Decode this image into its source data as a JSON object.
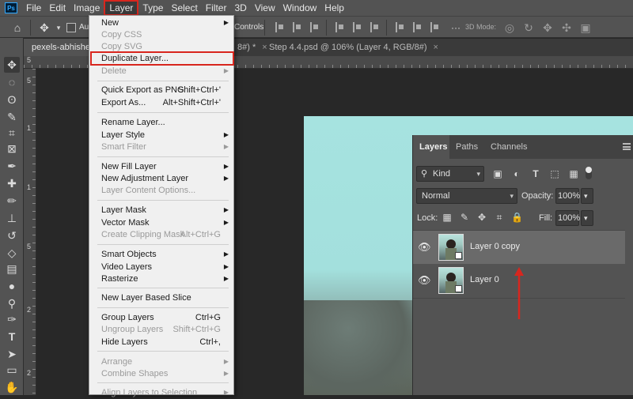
{
  "menubar": {
    "logo": "Ps",
    "items": [
      "File",
      "Edit",
      "Image",
      "Layer",
      "Type",
      "Select",
      "Filter",
      "3D",
      "View",
      "Window",
      "Help"
    ]
  },
  "options_bar": {
    "auto_select_label": "Au",
    "transform_controls_label": "Controls",
    "mode_3d_label": "3D Mode:"
  },
  "tabs": [
    {
      "label": "pexels-abhishek",
      "close": "×"
    },
    {
      "label": "8#) *",
      "close": "×"
    },
    {
      "label": "Step 4.4.psd @ 106% (Layer 4, RGB/8#)",
      "close": "×"
    }
  ],
  "rulers": {
    "top_mark": "5",
    "left_marks": [
      "5",
      "1",
      "1",
      "5",
      "2",
      "2"
    ]
  },
  "layer_menu": {
    "items": [
      {
        "label": "New",
        "shortcut": "",
        "submenu": true,
        "disabled": false
      },
      {
        "label": "Copy CSS",
        "shortcut": "",
        "submenu": false,
        "disabled": true
      },
      {
        "label": "Copy SVG",
        "shortcut": "",
        "submenu": false,
        "disabled": true
      },
      {
        "label": "Duplicate Layer...",
        "shortcut": "",
        "submenu": false,
        "disabled": false
      },
      {
        "label": "Delete",
        "shortcut": "",
        "submenu": true,
        "disabled": true
      },
      {
        "label": "Quick Export as PNG",
        "shortcut": "Shift+Ctrl+'",
        "submenu": false,
        "disabled": false
      },
      {
        "label": "Export As...",
        "shortcut": "Alt+Shift+Ctrl+'",
        "submenu": false,
        "disabled": false
      },
      {
        "label": "Rename Layer...",
        "shortcut": "",
        "submenu": false,
        "disabled": false
      },
      {
        "label": "Layer Style",
        "shortcut": "",
        "submenu": true,
        "disabled": false
      },
      {
        "label": "Smart Filter",
        "shortcut": "",
        "submenu": true,
        "disabled": true
      },
      {
        "label": "New Fill Layer",
        "shortcut": "",
        "submenu": true,
        "disabled": false
      },
      {
        "label": "New Adjustment Layer",
        "shortcut": "",
        "submenu": true,
        "disabled": false
      },
      {
        "label": "Layer Content Options...",
        "shortcut": "",
        "submenu": false,
        "disabled": true
      },
      {
        "label": "Layer Mask",
        "shortcut": "",
        "submenu": true,
        "disabled": false
      },
      {
        "label": "Vector Mask",
        "shortcut": "",
        "submenu": true,
        "disabled": false
      },
      {
        "label": "Create Clipping Mask",
        "shortcut": "Alt+Ctrl+G",
        "submenu": false,
        "disabled": true
      },
      {
        "label": "Smart Objects",
        "shortcut": "",
        "submenu": true,
        "disabled": false
      },
      {
        "label": "Video Layers",
        "shortcut": "",
        "submenu": true,
        "disabled": false
      },
      {
        "label": "Rasterize",
        "shortcut": "",
        "submenu": true,
        "disabled": false
      },
      {
        "label": "New Layer Based Slice",
        "shortcut": "",
        "submenu": false,
        "disabled": false
      },
      {
        "label": "Group Layers",
        "shortcut": "Ctrl+G",
        "submenu": false,
        "disabled": false
      },
      {
        "label": "Ungroup Layers",
        "shortcut": "Shift+Ctrl+G",
        "submenu": false,
        "disabled": true
      },
      {
        "label": "Hide Layers",
        "shortcut": "Ctrl+,",
        "submenu": false,
        "disabled": false
      },
      {
        "label": "Arrange",
        "shortcut": "",
        "submenu": true,
        "disabled": true
      },
      {
        "label": "Combine Shapes",
        "shortcut": "",
        "submenu": true,
        "disabled": true
      },
      {
        "label": "Align Layers to Selection",
        "shortcut": "",
        "submenu": true,
        "disabled": true
      }
    ]
  },
  "layers_panel": {
    "tabs": [
      "Layers",
      "Paths",
      "Channels"
    ],
    "filter_kind": "Kind",
    "blend_mode": "Normal",
    "opacity_label": "Opacity:",
    "opacity_value": "100%",
    "lock_label": "Lock:",
    "fill_label": "Fill:",
    "fill_value": "100%",
    "layers": [
      {
        "name": "Layer 0 copy",
        "selected": true
      },
      {
        "name": "Layer 0",
        "selected": false
      }
    ]
  },
  "colors": {
    "highlight_red": "#d8261e",
    "panel_bg": "#535353",
    "canvas_sky": "#a6e3e0"
  }
}
